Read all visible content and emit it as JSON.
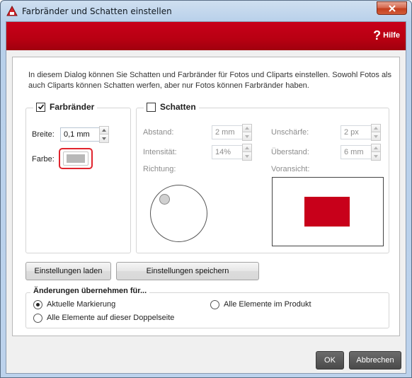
{
  "window": {
    "title": "Farbränder und Schatten einstellen",
    "help_label": "Hilfe",
    "accent_color": "#b80012"
  },
  "intro_text": "In diesem Dialog können Sie Schatten und Farbränder für Fotos und Cliparts einstellen. Sowohl Fotos als auch Cliparts können Schatten werfen, aber nur Fotos können Farbränder haben.",
  "borders": {
    "title": "Farbränder",
    "checked": true,
    "width_label": "Breite:",
    "width_value": "0,1 mm",
    "color_label": "Farbe:",
    "color_value": "#b8b8b8"
  },
  "shadow": {
    "title": "Schatten",
    "checked": false,
    "distance_label": "Abstand:",
    "distance_value": "2 mm",
    "blur_label": "Unschärfe:",
    "blur_value": "2 px",
    "intensity_label": "Intensität:",
    "intensity_value": "14%",
    "overhang_label": "Überstand:",
    "overhang_value": "6 mm",
    "direction_label": "Richtung:",
    "preview_label": "Voransicht:",
    "preview_color": "#c8001a"
  },
  "buttons": {
    "load_settings": "Einstellungen laden",
    "save_settings": "Einstellungen speichern",
    "ok": "OK",
    "cancel": "Abbrechen"
  },
  "apply": {
    "title": "Änderungen übernehmen für...",
    "option_current": "Aktuelle Markierung",
    "option_all_product": "Alle Elemente im Produkt",
    "option_spread": "Alle Elemente auf dieser Doppelseite",
    "selected": "current"
  }
}
